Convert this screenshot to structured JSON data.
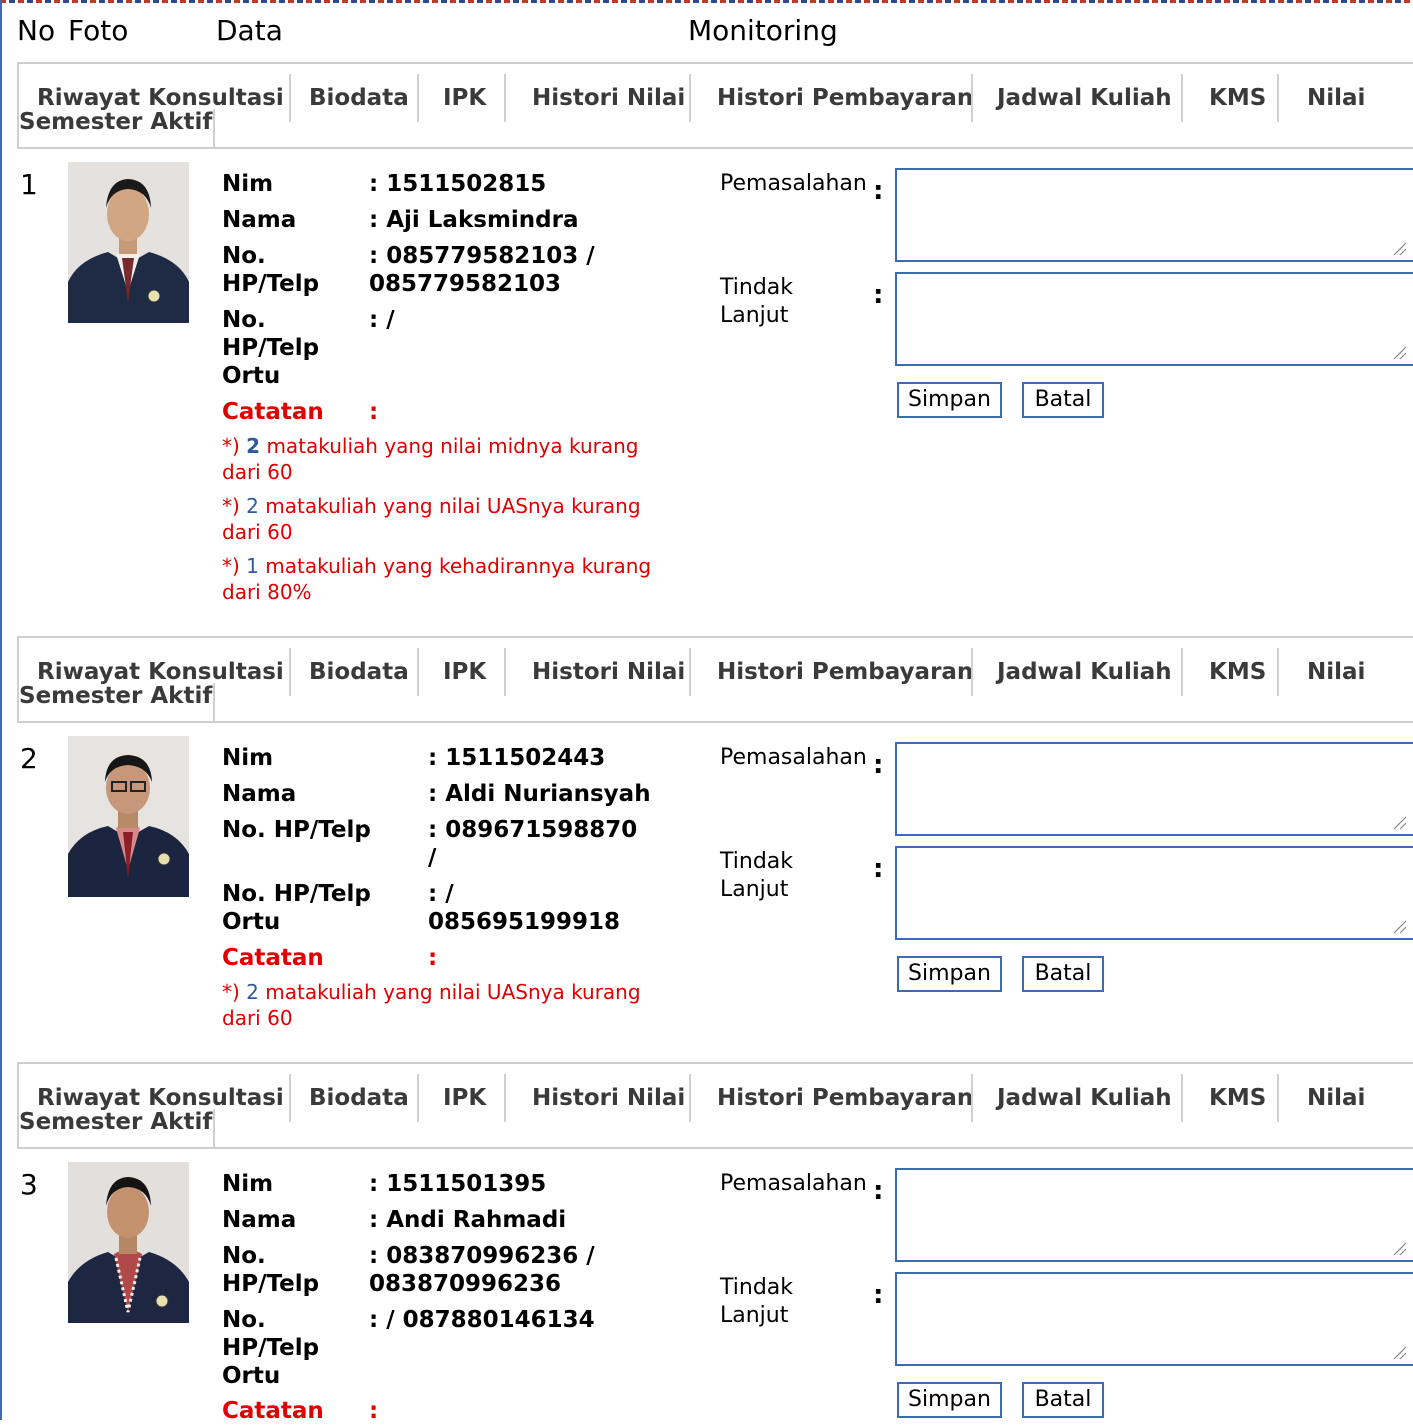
{
  "headers": {
    "no": "No",
    "foto": "Foto",
    "data": "Data",
    "monitoring": "Monitoring"
  },
  "tabs": [
    "Riwayat Konsultasi",
    "Biodata",
    "IPK",
    "Histori Nilai",
    "Histori Pembayaran",
    "Jadwal Kuliah",
    "KMS",
    "Nilai",
    "Semester Aktif"
  ],
  "labels": {
    "nim": "Nim",
    "nama": "Nama",
    "hp_a": "No.",
    "hp_b": "HP/Telp",
    "hp_full": "No. HP/Telp",
    "hportu_c": "Ortu",
    "catatan": "Catatan",
    "colon": ":",
    "pemasalahan": "Pemasalahan",
    "tindak_a": "Tindak",
    "tindak_b": "Lanjut",
    "simpan": "Simpan",
    "batal": "Batal",
    "note_prefix": "*)"
  },
  "students": [
    {
      "no": "1",
      "nim": ": 1511502815",
      "nama": ": Aji Laksmindra",
      "hp_l1": ": 085779582103 /",
      "hp_l2": "085779582103",
      "hportu": ": /",
      "notes": [
        {
          "count": "2",
          "t1": " matakuliah yang nilai midnya kurang",
          "t2": "dari 60"
        },
        {
          "count": "2",
          "t1": " matakuliah yang nilai UASnya kurang",
          "t2": "dari 60"
        },
        {
          "count": "1",
          "t1": " matakuliah yang kehadirannya kurang",
          "t2": "dari 80%"
        }
      ]
    },
    {
      "no": "2",
      "nim": ": 1511502443",
      "nama": ": Aldi Nuriansyah",
      "hp_l1": ": 089671598870",
      "hp_l2": "/",
      "hportu_l1": ": /",
      "hportu_l2": "085695199918",
      "notes": [
        {
          "count": "2",
          "t1": " matakuliah yang nilai UASnya kurang",
          "t2": "dari 60"
        }
      ]
    },
    {
      "no": "3",
      "nim": ": 1511501395",
      "nama": ": Andi Rahmadi",
      "hp_l1": ": 083870996236 /",
      "hp_l2": "083870996236",
      "hportu": ": / 087880146134"
    }
  ]
}
